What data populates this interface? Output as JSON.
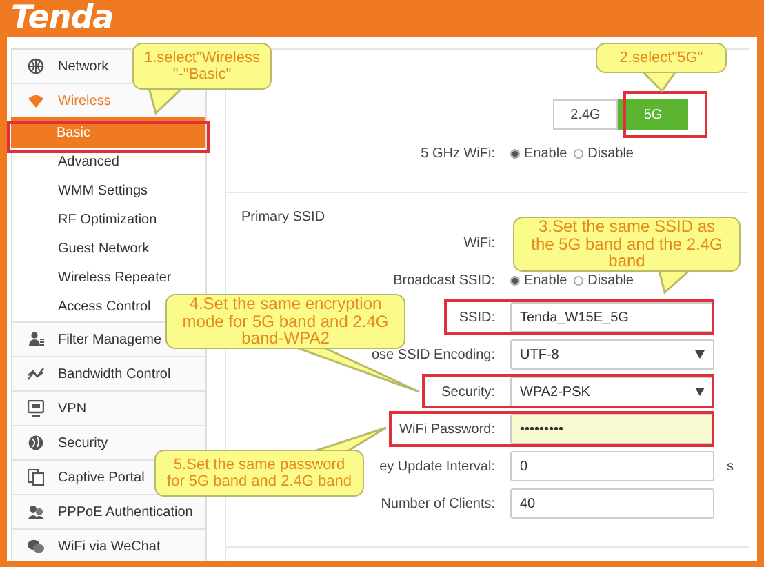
{
  "header": {
    "logo": "Tenda"
  },
  "sidebar": {
    "items": [
      {
        "label": "Network",
        "selected": false
      },
      {
        "label": "Wireless",
        "selected": true,
        "expanded": true,
        "children": [
          {
            "label": "Basic",
            "selected": true
          },
          {
            "label": "Advanced",
            "selected": false
          },
          {
            "label": "WMM Settings",
            "selected": false
          },
          {
            "label": "RF Optimization",
            "selected": false
          },
          {
            "label": "Guest Network",
            "selected": false
          },
          {
            "label": "Wireless Repeater",
            "selected": false
          },
          {
            "label": "Access Control",
            "selected": false
          }
        ]
      },
      {
        "label": "Filter Manageme",
        "selected": false
      },
      {
        "label": "Bandwidth Control",
        "selected": false
      },
      {
        "label": "VPN",
        "selected": false
      },
      {
        "label": "Security",
        "selected": false
      },
      {
        "label": "Captive Portal",
        "selected": false
      },
      {
        "label": "PPPoE Authentication",
        "selected": false
      },
      {
        "label": "WiFi via WeChat",
        "selected": false
      }
    ]
  },
  "wifi_settings": {
    "band_tabs": [
      {
        "label": "2.4G",
        "selected": false
      },
      {
        "label": "5G",
        "selected": true
      }
    ],
    "rows": [
      {
        "kind": "radio",
        "label": "5 GHz WiFi:",
        "options": [
          {
            "label": "Enable",
            "selected": true
          },
          {
            "label": "Disable",
            "selected": false
          }
        ]
      }
    ]
  },
  "primary_ssid": {
    "title": "Primary SSID",
    "rows": [
      {
        "kind": "radio",
        "label": "WiFi:"
      },
      {
        "kind": "radio",
        "label": "Broadcast SSID:",
        "options": [
          {
            "label": "Enable",
            "selected": true
          },
          {
            "label": "Disable",
            "selected": false
          }
        ]
      },
      {
        "kind": "text",
        "label": "SSID:",
        "value": "Tenda_W15E_5G"
      },
      {
        "kind": "select",
        "label": "ose SSID Encoding:",
        "value": "UTF-8"
      },
      {
        "kind": "select",
        "label": "Security:",
        "value": "WPA2-PSK"
      },
      {
        "kind": "password",
        "label": "WiFi Password:",
        "value": "•••••••••"
      },
      {
        "kind": "text",
        "label": "ey Update Interval:",
        "value": "0",
        "suffix": "s"
      },
      {
        "kind": "text",
        "label": "Number of Clients:",
        "value": "40"
      }
    ]
  },
  "callouts": [
    {
      "text": "1.select\"Wireless \"-\"Basic\""
    },
    {
      "text": "2.select\"5G\""
    },
    {
      "text": "3.Set the same SSID as the 5G band and the 2.4G band"
    },
    {
      "text": "4.Set the same encryption mode for 5G band and 2.4G band-WPA2"
    },
    {
      "text": "5.Set the same password for 5G band and 2.4G band"
    }
  ]
}
